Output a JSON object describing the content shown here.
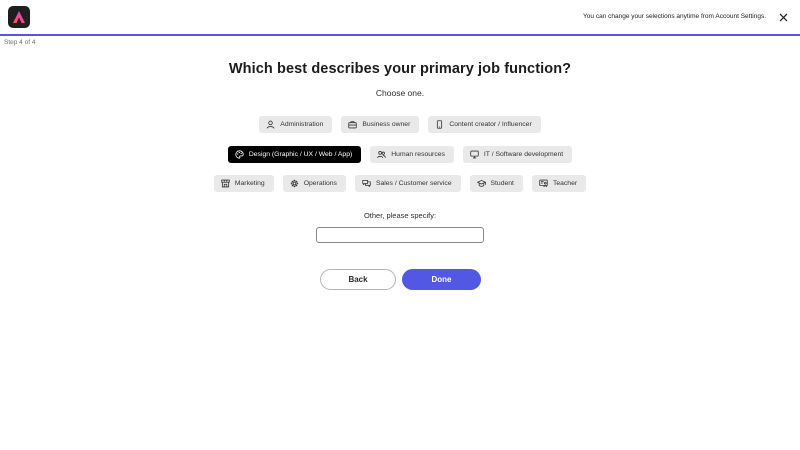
{
  "header": {
    "logo_icon": "adobe-express-logo",
    "notice": "You can change your selections anytime from Account Settings.",
    "close_icon": "close-icon",
    "progress_color": "#5258e4"
  },
  "step_label": "Step 4 of 4",
  "question": {
    "title": "Which best describes your primary job function?",
    "subtitle": "Choose one."
  },
  "options": [
    {
      "label": "Administration",
      "icon": "person-icon",
      "selected": false
    },
    {
      "label": "Business owner",
      "icon": "briefcase-icon",
      "selected": false
    },
    {
      "label": "Content creator / Influencer",
      "icon": "phone-icon",
      "selected": false
    },
    {
      "label": "Design (Graphic / UX / Web / App)",
      "icon": "palette-icon",
      "selected": true
    },
    {
      "label": "Human resources",
      "icon": "people-icon",
      "selected": false
    },
    {
      "label": "IT / Software development",
      "icon": "monitor-icon",
      "selected": false
    },
    {
      "label": "Marketing",
      "icon": "storefront-icon",
      "selected": false
    },
    {
      "label": "Operations",
      "icon": "gear-icon",
      "selected": false
    },
    {
      "label": "Sales / Customer service",
      "icon": "chat-bubbles-icon",
      "selected": false
    },
    {
      "label": "Student",
      "icon": "graduation-cap-icon",
      "selected": false
    },
    {
      "label": "Teacher",
      "icon": "teacher-board-icon",
      "selected": false
    }
  ],
  "other": {
    "label": "Other, please specify:",
    "value": "",
    "placeholder": ""
  },
  "buttons": {
    "back": "Back",
    "done": "Done"
  },
  "colors": {
    "accent": "#5258e4",
    "chip_bg": "#e9e9e9",
    "chip_selected_bg": "#000000"
  }
}
